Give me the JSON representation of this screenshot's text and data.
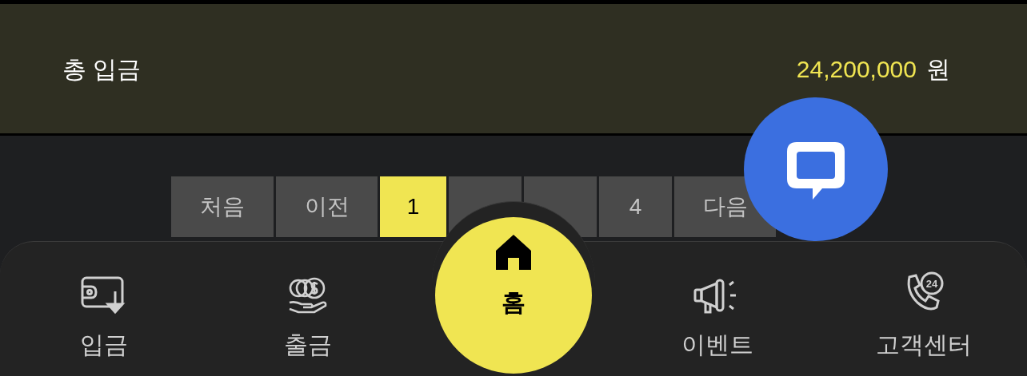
{
  "summary": {
    "label": "총 입금",
    "amount": "24,200,000",
    "unit": "원"
  },
  "pagination": [
    {
      "kind": "page",
      "label": "처음",
      "selected": false
    },
    {
      "kind": "page",
      "label": "이전",
      "selected": false
    },
    {
      "kind": "page",
      "label": "1",
      "selected": true
    },
    {
      "kind": "hidden",
      "selected": false
    },
    {
      "kind": "hidden",
      "selected": false
    },
    {
      "kind": "page",
      "label": "4",
      "selected": false
    },
    {
      "kind": "page",
      "label": "다음",
      "selected": false
    }
  ],
  "bottom_nav": [
    {
      "kind": "deposit",
      "label": "입금",
      "selected": false
    },
    {
      "kind": "withdraw",
      "label": "출금",
      "selected": false
    },
    {
      "kind": "home",
      "label": "홈",
      "selected": true
    },
    {
      "kind": "event",
      "label": "이벤트",
      "selected": false
    },
    {
      "kind": "support",
      "label": "고객센터",
      "icon_text": "24",
      "selected": false
    }
  ]
}
